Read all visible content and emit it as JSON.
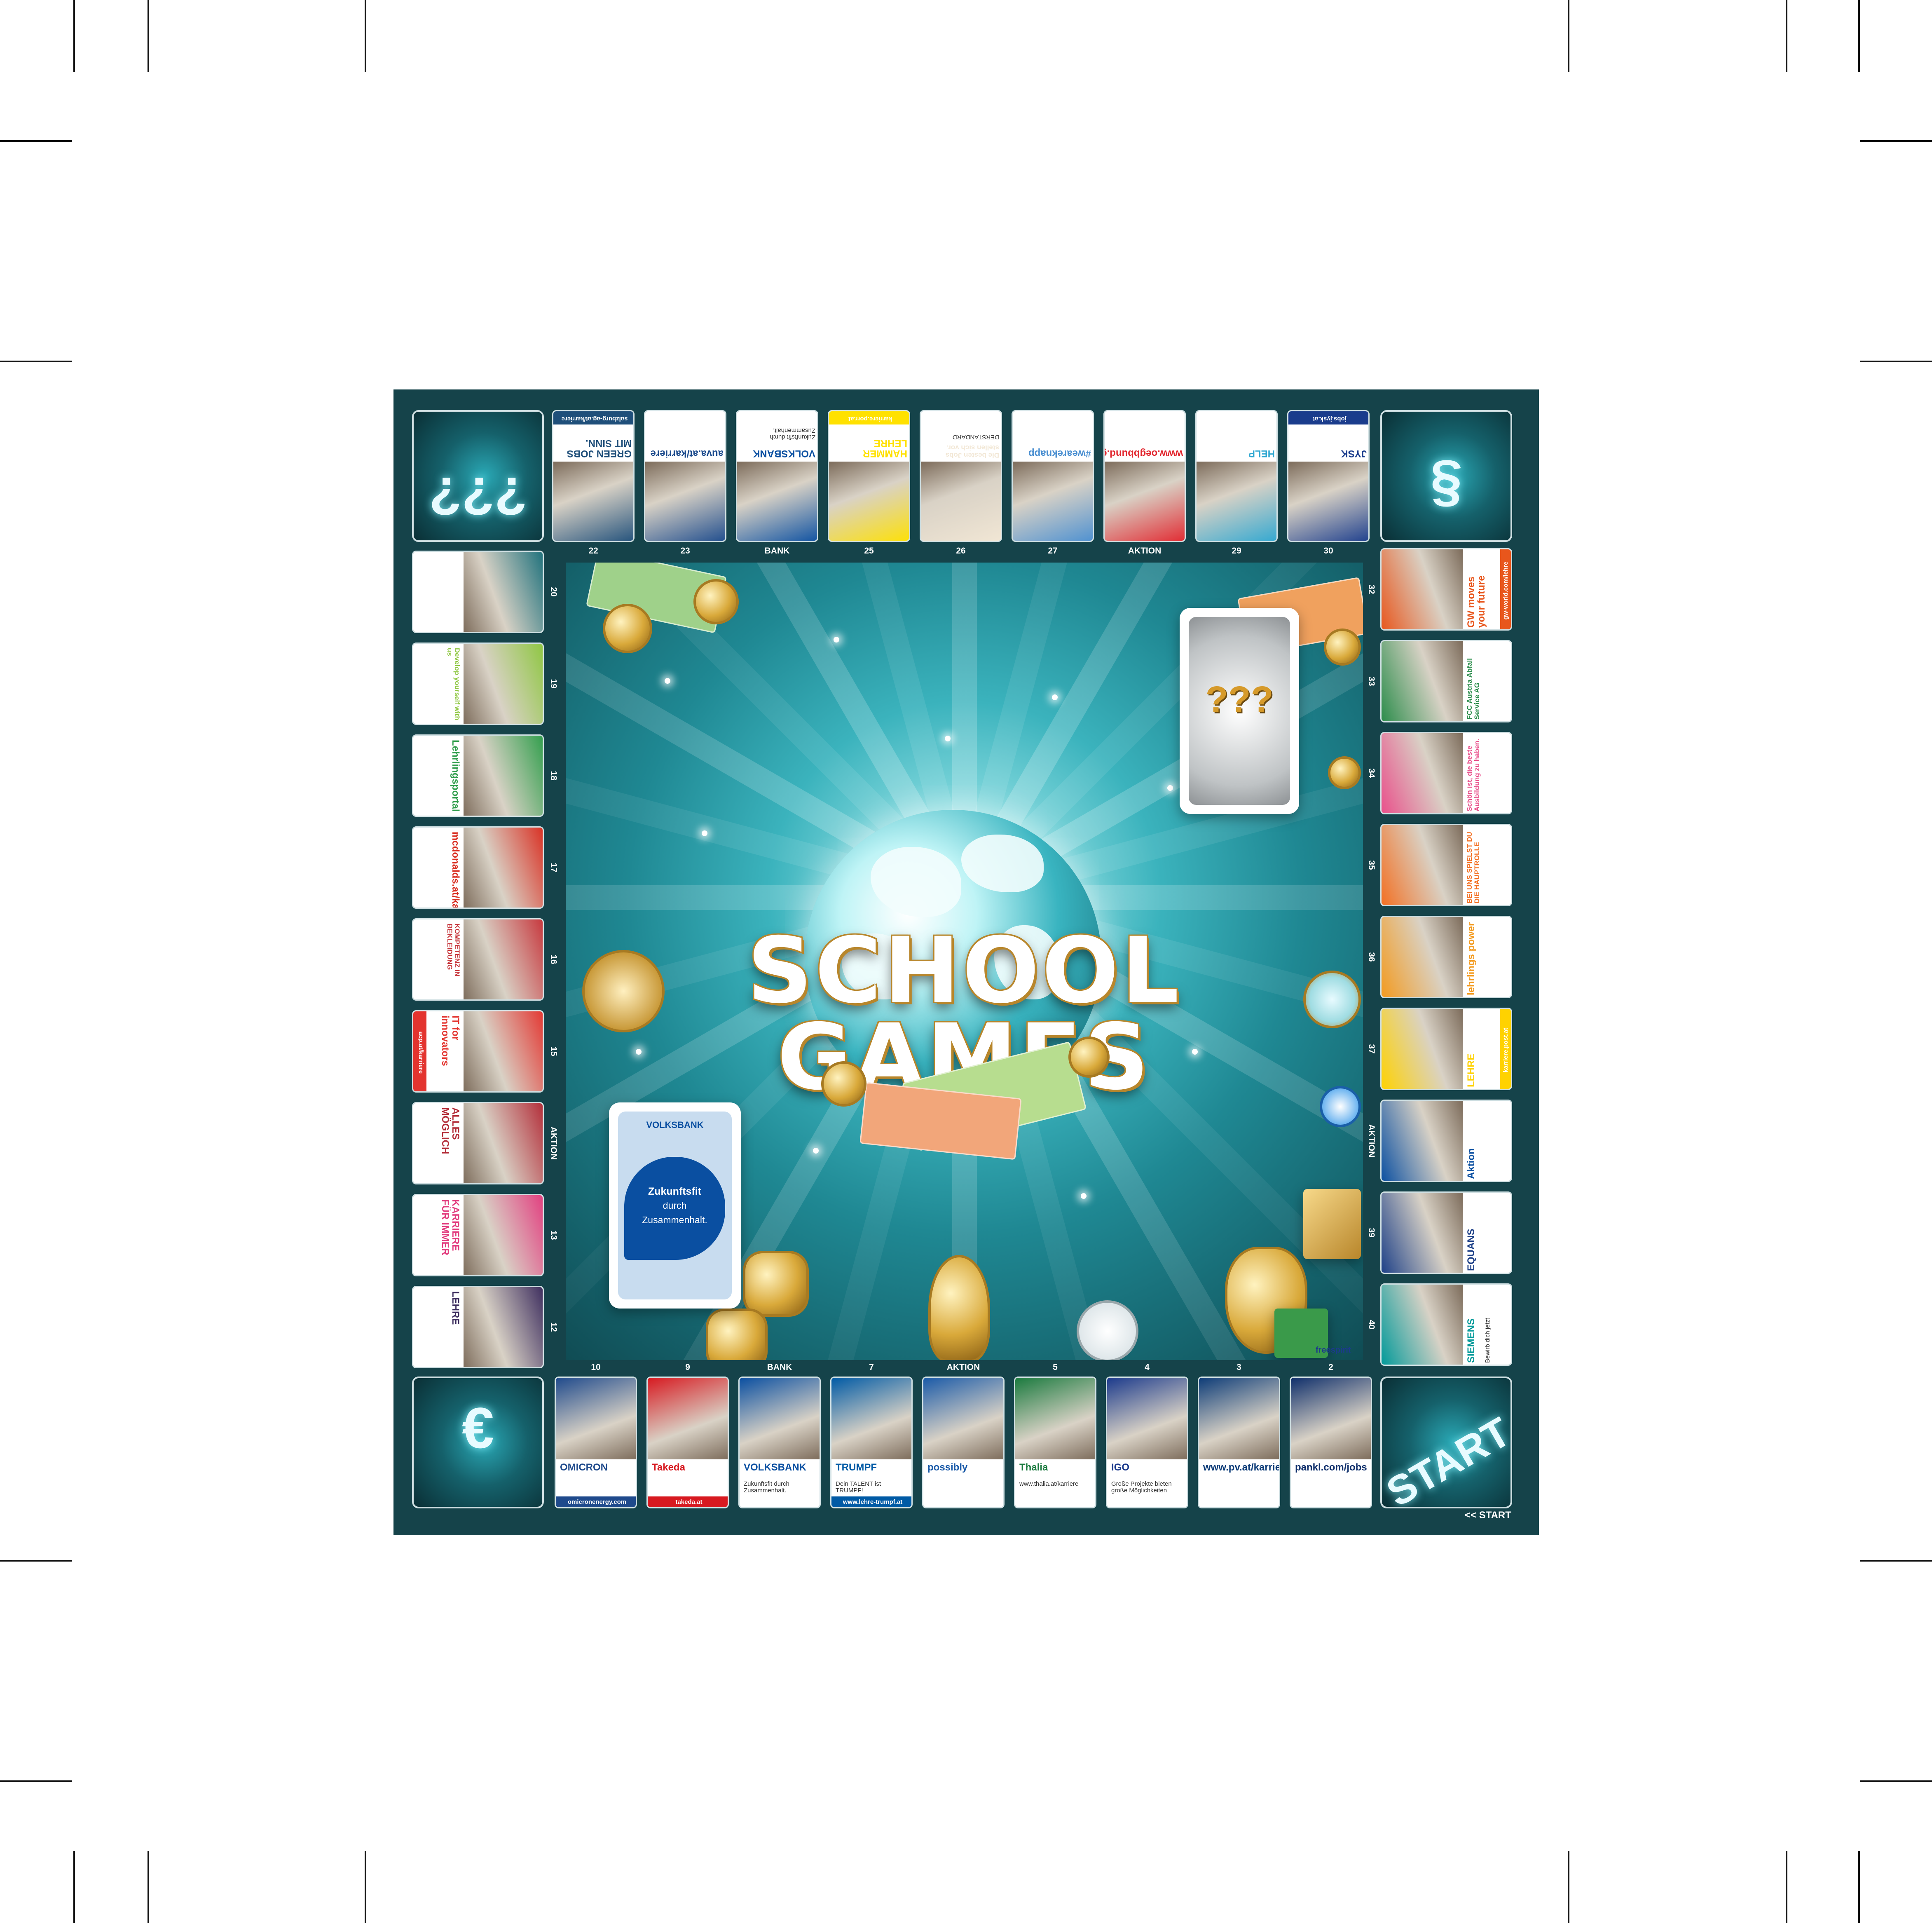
{
  "game": {
    "title_line1": "SCHOOL",
    "title_line2": "GAMES",
    "start_label": "START",
    "start_arrow_label": "<< START"
  },
  "bank_card": {
    "brand": "VOLKSBANK",
    "slogan_line1": "Zukunftsfit",
    "slogan_line2": "durch",
    "slogan_line3": "Zusammenhalt."
  },
  "colors": {
    "board_frame": "#15434a",
    "center_glow": "#8fdfe3",
    "gold": "#b8862b",
    "volksbank_blue": "#0a4fa1"
  },
  "bottom_row": [
    {
      "number": "2",
      "name": "pankl",
      "text": "pankl.com/jobs",
      "color": "#0f2f6b"
    },
    {
      "number": "3",
      "name": "pv",
      "text": "www.pv.at/karriere",
      "color": "#0d3c78"
    },
    {
      "number": "4",
      "name": "IGO industries",
      "text": "IGO",
      "sub": "Große Projekte bieten große Möglichkeiten",
      "color": "#1b3a8c"
    },
    {
      "number": "5",
      "name": "Thalia",
      "text": "Thalia",
      "sub": "www.thalia.at/karriere",
      "color": "#1a7a3e"
    },
    {
      "number": "AKTION",
      "name": "possibly",
      "text": "possibly",
      "color": "#1a5aa8"
    },
    {
      "number": "7",
      "name": "TRUMPF",
      "text": "TRUMPF",
      "sub": "Dein TALENT ist TRUMPF!",
      "url": "www.lehre-trumpf.at",
      "color": "#005aa5"
    },
    {
      "number": "BANK",
      "name": "Volksbank",
      "text": "VOLKSBANK",
      "sub": "Zukunftsfit durch Zusammenhalt.",
      "color": "#0a4fa1"
    },
    {
      "number": "9",
      "name": "Takeda",
      "text": "Takeda",
      "url": "takeda.at",
      "color": "#d71920"
    },
    {
      "number": "10",
      "name": "OMICRON",
      "text": "OMICRON",
      "url": "omicronenergy.com",
      "color": "#1f4a8c"
    }
  ],
  "left_column": [
    {
      "number": "12",
      "name": "OBB Lehre",
      "text": "LEHRE",
      "color": "#3a2a5c"
    },
    {
      "number": "13",
      "name": "Karriere",
      "text": "KARRIERE FÜR IMMER",
      "color": "#e23c7e"
    },
    {
      "number": "AKTION",
      "name": "Alles möglich",
      "text": "ALLES MÖGLICH",
      "color": "#b22a36"
    },
    {
      "number": "15",
      "name": "ACP",
      "text": "IT for innovators",
      "url": "acp.at/karriere",
      "color": "#e3342f"
    },
    {
      "number": "16",
      "name": "HMB",
      "text": "KOMPETENZ IN BEKLEIDUNG",
      "color": "#c6343a"
    },
    {
      "number": "17",
      "name": "McDonald's",
      "text": "mcdonalds.at/karriere",
      "color": "#d92d20"
    },
    {
      "number": "18",
      "name": "Lehrlingsportal",
      "text": "Lehrlingsportal",
      "color": "#2e9d4a"
    },
    {
      "number": "19",
      "name": "Develop yourself",
      "text": "Develop yourself with us",
      "color": "#8dc63f"
    },
    {
      "number": "20",
      "name": "Business",
      "text": "",
      "color": "#1b6f7a"
    }
  ],
  "top_row": [
    {
      "number": "22",
      "name": "Salzburg AG",
      "text": "GREEN JOBS MIT SINN.",
      "url": "salzburg-ag.at/karriere",
      "color": "#1f4f7a"
    },
    {
      "number": "23",
      "name": "AUVA",
      "text": "auva.at/karriere",
      "color": "#1b4a8c"
    },
    {
      "number": "BANK",
      "name": "Volksbank",
      "text": "VOLKSBANK",
      "sub": "Zukunftsfit durch Zusammenhalt.",
      "color": "#0a4fa1"
    },
    {
      "number": "25",
      "name": "Hammer Lehre",
      "text": "HAMMER LEHRE",
      "url": "karriere.porr.at",
      "color": "#ffe100"
    },
    {
      "number": "26",
      "name": "Der Standard",
      "text": "Die besten Jobs stellen sich vor.",
      "sub": "DERSTANDARD",
      "color": "#f2e7d5"
    },
    {
      "number": "27",
      "name": "Knapp",
      "text": "#weareknapp",
      "color": "#4a8fd1"
    },
    {
      "number": "AKTION",
      "name": "Gewerkschaft",
      "text": "www.oegbbund.gv.at",
      "color": "#e2262e"
    },
    {
      "number": "29",
      "name": "Hilfswerk",
      "text": "HELP",
      "color": "#2ea7d1"
    },
    {
      "number": "30",
      "name": "JYSK",
      "text": "JYSK",
      "url": "jobs.jysk.at",
      "color": "#1a3c8c"
    }
  ],
  "right_column": [
    {
      "number": "32",
      "name": "GW",
      "text": "GW moves your future",
      "url": "gw-world.com/lehre",
      "color": "#e8561c"
    },
    {
      "number": "33",
      "name": "FCC",
      "text": "FCC Austria Abfall Service AG",
      "color": "#2a8c4a"
    },
    {
      "number": "34",
      "name": "Bipa",
      "text": "Schön ist, die beste Ausbildung zu haben.",
      "color": "#e94f8a"
    },
    {
      "number": "35",
      "name": "Rolle",
      "text": "BEI UNS SPIELST DU DIE HAUPTROLLE",
      "color": "#f36f21"
    },
    {
      "number": "36",
      "name": "Lehrlingspower",
      "text": "lehrlings power",
      "color": "#f39a1e"
    },
    {
      "number": "37",
      "name": "Post Lehre",
      "text": "LEHRE",
      "url": "karriere.post.at",
      "color": "#ffd200"
    },
    {
      "number": "AKTION",
      "name": "Aktion",
      "text": "Aktion",
      "color": "#0a4fa1"
    },
    {
      "number": "39",
      "name": "EQUANS",
      "text": "EQUANS",
      "color": "#1c3f87"
    },
    {
      "number": "40",
      "name": "SIEMENS",
      "text": "SIEMENS",
      "sub": "Bewirb dich jetzt",
      "color": "#009999"
    }
  ],
  "corners": {
    "bottom_left": "€",
    "top_left": "???",
    "top_right": "§",
    "bottom_right": "START"
  },
  "center_cards": {
    "top_right_deck": "???",
    "bottom_left_deck": "VOLKSBANK"
  },
  "decor": {
    "freespirit": "freespirit"
  }
}
